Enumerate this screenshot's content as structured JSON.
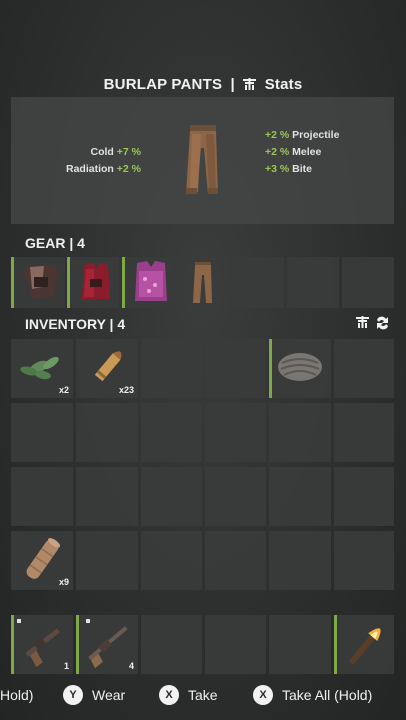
{
  "item": {
    "name": "BURLAP PANTS",
    "separator": "|",
    "stats_label": "Stats"
  },
  "stats_left": [
    {
      "label": "Cold",
      "value": "+7 %"
    },
    {
      "label": "Radiation",
      "value": "+2 %"
    }
  ],
  "stats_right": [
    {
      "value": "+2 %",
      "label": "Projectile"
    },
    {
      "value": "+2 %",
      "label": "Melee"
    },
    {
      "value": "+3 %",
      "label": "Bite"
    }
  ],
  "gear": {
    "label": "GEAR | 4",
    "slots": [
      {
        "icon": "burlap-shirt-icon",
        "selected": true
      },
      {
        "icon": "red-vest-icon",
        "selected": true
      },
      {
        "icon": "pink-armor-vest-icon",
        "selected": true
      },
      {
        "icon": "burlap-pants-icon",
        "selected": false
      },
      {
        "icon": "",
        "selected": false
      },
      {
        "icon": "",
        "selected": false
      },
      {
        "icon": "",
        "selected": false
      }
    ]
  },
  "inventory": {
    "label": "INVENTORY | 4",
    "items": [
      {
        "icon": "plant-fiber-icon",
        "count": "x2"
      },
      {
        "icon": "pistol-bullet-icon",
        "count": "x23"
      },
      {
        "icon": "cloth-icon",
        "count": ""
      },
      {
        "icon": "bandage-icon",
        "count": "x9"
      }
    ]
  },
  "toolbar": {
    "slots": [
      {
        "icon": "revolver-icon",
        "count": "1"
      },
      {
        "icon": "pipe-shotgun-icon",
        "count": "4"
      },
      {
        "icon": "",
        "count": ""
      },
      {
        "icon": "",
        "count": ""
      },
      {
        "icon": "",
        "count": ""
      },
      {
        "icon": "torch-icon",
        "count": ""
      }
    ]
  },
  "hints": {
    "hold": "Hold)",
    "y_button": "Y",
    "wear": "Wear",
    "x_button": "X",
    "take": "Take",
    "x_button2": "X",
    "take_all": "Take All (Hold)"
  }
}
